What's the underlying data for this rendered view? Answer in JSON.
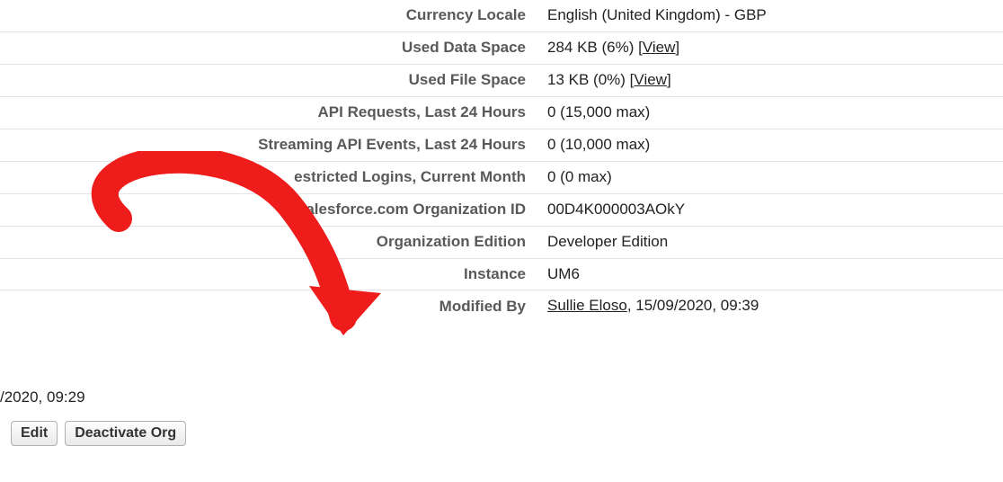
{
  "rows": {
    "currency_locale": {
      "label": "Currency Locale",
      "value": "English (United Kingdom) - GBP"
    },
    "used_data_space": {
      "label": "Used Data Space",
      "value": "284 KB (6%)",
      "link": "View"
    },
    "used_file_space": {
      "label": "Used File Space",
      "value": "13 KB (0%)",
      "link": "View"
    },
    "api_requests": {
      "label": "API Requests, Last 24 Hours",
      "value": "0 (15,000 max)"
    },
    "streaming_api": {
      "label": "Streaming API Events, Last 24 Hours",
      "value": "0 (10,000 max)"
    },
    "restricted": {
      "label": "estricted Logins, Current Month",
      "value": "0 (0 max)"
    },
    "org_id": {
      "label": "Salesforce.com Organization ID",
      "value": "00D4K000003AOkY"
    },
    "org_edition": {
      "label": "Organization Edition",
      "value": "Developer Edition"
    },
    "instance": {
      "label": "Instance",
      "value": "UM6"
    },
    "modified_by": {
      "label": "Modified By",
      "user": "Sullie Eloso",
      "when": ", 15/09/2020, 09:39"
    }
  },
  "left_clip": "/2020, 09:29",
  "buttons": {
    "edit": "Edit",
    "deactivate": "Deactivate Org"
  }
}
